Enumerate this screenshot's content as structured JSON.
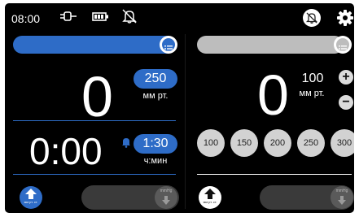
{
  "status_bar": {
    "time": "08:00",
    "icons": [
      "plug-icon",
      "battery-icon",
      "alarm-off-icon"
    ]
  },
  "header_right": {
    "icons": [
      "alarm-off-badge-icon",
      "gear-icon"
    ]
  },
  "left_panel": {
    "slider_accent": "#2e6cc7",
    "pressure_value": "0",
    "setpoint_value": "250",
    "pressure_unit": "мм рт.",
    "timer_value": "0:00",
    "timer_setpoint": "1:30",
    "timer_unit": "ч:мин",
    "bottom_button_label": "мм рт. ст.",
    "bottom_slider_label": "mmHg"
  },
  "right_panel": {
    "slider_color": "#bdbdbd",
    "pressure_value": "0",
    "setpoint_value": "100",
    "pressure_unit": "мм рт.",
    "presets": [
      "100",
      "150",
      "200",
      "250",
      "300"
    ],
    "bottom_button_label": "мм рт. ст.",
    "bottom_slider_label": "mmHg"
  },
  "colors": {
    "accent_blue": "#2e6cc7",
    "gray": "#bdbdbd",
    "dark_gray": "#3a3a3a"
  }
}
